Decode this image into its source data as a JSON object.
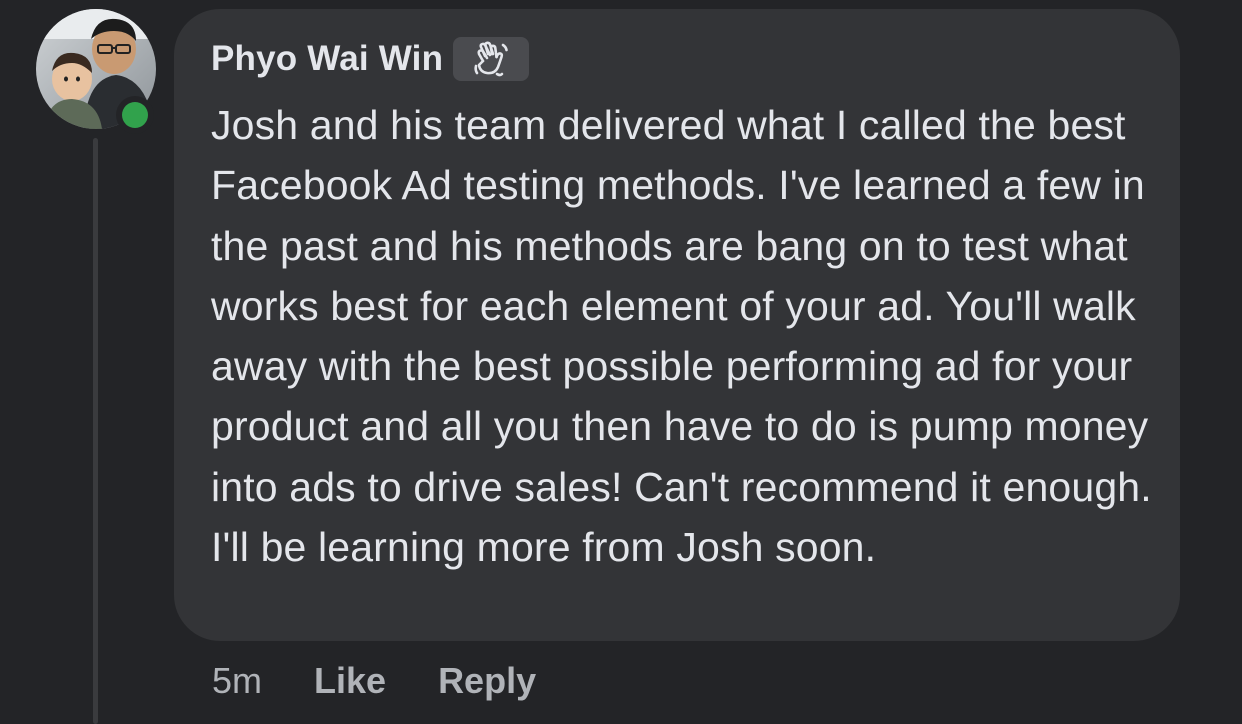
{
  "comment": {
    "author": "Phyo Wai Win",
    "badge_icon": "waving-hand-icon",
    "text": "Josh and his team delivered what I called the best Facebook Ad testing methods. I've learned a few in the past and his methods are bang on to test what works best for each element of your ad. You'll walk away with the best possible performing ad for your product and all you then have to do is pump money into ads to drive sales! Can't recommend it enough. I'll be learning more from Josh soon.",
    "timestamp": "5m",
    "like_label": "Like",
    "reply_label": "Reply",
    "online": true
  },
  "colors": {
    "background": "#232427",
    "bubble": "#333437",
    "text": "#e4e6eb",
    "secondary_text": "#b0b3b8",
    "online_status": "#31a24c"
  }
}
